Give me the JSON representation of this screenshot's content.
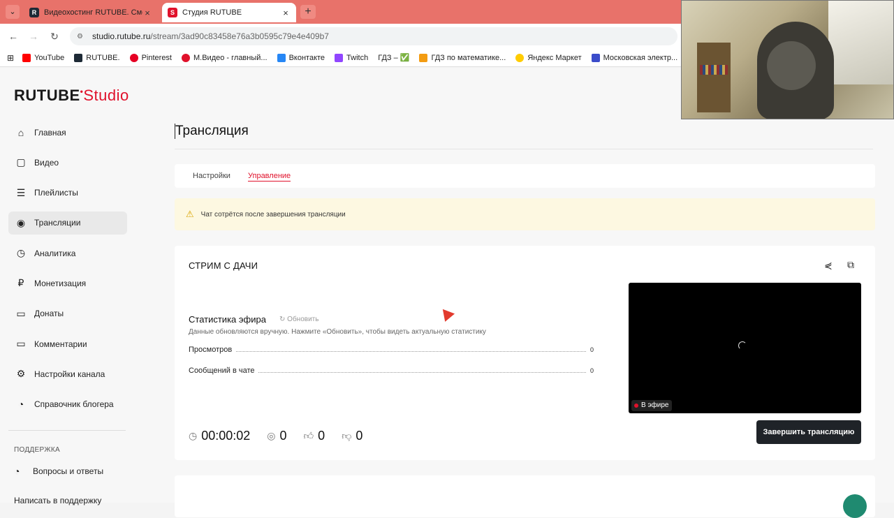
{
  "browser": {
    "tabs": [
      {
        "title": "Видеохостинг RUTUBE. Смотр",
        "favicon": "R",
        "favicon_color": "#1e2a36",
        "active": false
      },
      {
        "title": "Студия RUTUBE",
        "favicon": "S",
        "favicon_color": "#e0112b",
        "active": true
      }
    ],
    "url_domain": "studio.rutube.ru",
    "url_path": "/stream/3ad90c83458e76a3b0595c79e4e409b7",
    "bookmarks": [
      {
        "label": "YouTube",
        "color": "#ff0000"
      },
      {
        "label": "RUTUBE.",
        "color": "#1e2a36"
      },
      {
        "label": "Pinterest",
        "color": "#e60023"
      },
      {
        "label": "М.Видео - главный...",
        "color": "#e0112b"
      },
      {
        "label": "Вконтакте",
        "color": "#2787f5"
      },
      {
        "label": "Twitch",
        "color": "#9146ff"
      },
      {
        "label": "ГДЗ – ✅",
        "color": "#4caf50"
      },
      {
        "label": "ГДЗ по математике...",
        "color": "#f39c12"
      },
      {
        "label": "Яндекс Маркет",
        "color": "#ffcc00"
      },
      {
        "label": "Московская электр...",
        "color": "#3b4cca"
      }
    ]
  },
  "logo": {
    "main": "RUTUBE",
    "sub": "Studio"
  },
  "sidebar": {
    "items": [
      {
        "label": "Главная",
        "icon": "⌂"
      },
      {
        "label": "Видео",
        "icon": "▢"
      },
      {
        "label": "Плейлисты",
        "icon": "☰"
      },
      {
        "label": "Трансляции",
        "icon": "◉"
      },
      {
        "label": "Аналитика",
        "icon": "◷"
      },
      {
        "label": "Монетизация",
        "icon": "₽"
      },
      {
        "label": "Донаты",
        "icon": "▭"
      },
      {
        "label": "Комментарии",
        "icon": "▭"
      },
      {
        "label": "Настройки канала",
        "icon": "⚙"
      },
      {
        "label": "Справочник блогера",
        "icon": "◔"
      }
    ],
    "active_index": 3,
    "section_title": "ПОДДЕРЖКА",
    "help_label": "Вопросы и ответы",
    "help_icon": "◔",
    "more_label": "Написать в поддержку"
  },
  "main": {
    "title": "Трансляция",
    "tabs": [
      {
        "label": "Настройки"
      },
      {
        "label": "Управление"
      }
    ],
    "active_tab": 1,
    "notice": "Чат сотрётся после завершения трансляции",
    "stream": {
      "name": "СТРИМ С ДАЧИ",
      "stats_title": "Статистика эфира",
      "refresh": "Обновить",
      "stats_note": "Данные обновляются вручную. Нажмите «Обновить», чтобы видеть актуальную статистику",
      "views_label": "Просмотров",
      "views_value": "0",
      "chat_label": "Сообщений в чате",
      "chat_value": "0",
      "live_badge": "В эфире",
      "timer": "00:00:02",
      "viewers": "0",
      "likes": "0",
      "dislikes": "0",
      "end_button": "Завершить трансляцию"
    }
  },
  "colors": {
    "accent": "#e0112b",
    "tab_bar": "#e8726a",
    "notice_bg": "#fdf8e1",
    "button_dark": "#1f2328"
  }
}
